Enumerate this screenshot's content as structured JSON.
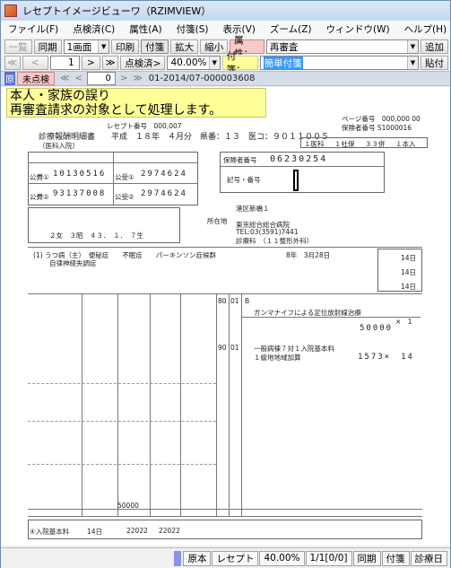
{
  "window": {
    "title": "レセプトイメージビューワ（RZIMVIEW）"
  },
  "menu": [
    "ファイル(F)",
    "点検済(C)",
    "属性(A)",
    "付箋(S)",
    "表示(V)",
    "ズーム(Z)",
    "ウィンドウ(W)",
    "ヘルプ(H)"
  ],
  "toolbar1": {
    "list": "一覧",
    "sync": "同期",
    "screen_select": "1画面",
    "print": "印刷",
    "sticky": "付箋",
    "zoom_in": "拡大",
    "zoom_out": "縮小",
    "attribute_label": "属性：",
    "attribute_value": "再審査",
    "add": "追加"
  },
  "toolbar2": {
    "first": "≪",
    "prev": "<",
    "page": "1",
    "next": ">",
    "last": "≫",
    "checked": "点検済>",
    "zoom": "40.00%",
    "sticky_label": "付箋：",
    "sticky_value": "簡単付箋",
    "paste": "貼付"
  },
  "nav": {
    "badge": "原",
    "tag": "未点検",
    "first": "≪",
    "prev": "<",
    "page": "0",
    "next": ">",
    "last": "≫",
    "doc_id": "01-2014/07-000003608"
  },
  "note": {
    "line1": "本人・家族の誤り",
    "line2": "再審査請求の対象として処理します。"
  },
  "receipt": {
    "receipt_no": "レセプト番号　000,007",
    "page_no": "ページ番号　000,000 00",
    "insurer_no": "保険者番号 S1000016",
    "head1": "診療報酬明細書　　平成　１８年　４月分　県番：１３　医コ：９０１１００５",
    "head2": "（医科入院）",
    "public1_label": "公費①",
    "public1_no": "10130516",
    "public2_label": "公費②",
    "public2_no": "93137008",
    "recipient1_label": "公受①",
    "recipient1_no": "2974624",
    "recipient2_label": "公受②",
    "recipient2_no": "2974624",
    "insurer_label": "保険者番号",
    "insurer_digits": "06230254",
    "symbol_label": "記号・番号",
    "kind1": "１医科",
    "kind2": "１社保",
    "kind3": "３３併",
    "kind4": "１本入",
    "name": "２女　３昭　４３．　１．　７生",
    "address_label": "所在地",
    "hospital_area": "港区新橋１",
    "hospital_name": "東京総合総合病院",
    "hospital_tel": "TEL:03(3591)7441",
    "hospital_dept": "診療科　（１１整形外科）",
    "disease": "(1) うつ病（主）　便秘症　　不眠症　　パーキンソン症候群",
    "disease2": "自律神経失調症",
    "start_date": "8年　3月28日",
    "day_a": "14日",
    "day_b": "14日",
    "day_c": "14日",
    "row_80": "80",
    "row_80b": "01",
    "row_90": "90",
    "row_90b": "01",
    "item_b": "B",
    "item_b_text": "ガンマナイフによる定位放射線治療",
    "item_b_qty": "×　1",
    "item_b_amount": "50000",
    "item_bed": "一般病棟７対１入院基本料",
    "item_bed2": "１級地地域加算",
    "item_bed_amount": "1573×　14",
    "sum_a": "50000",
    "total_label": "④入院基本料",
    "total_days": "14日",
    "total_pts": "22022",
    "total_pts2": "22022"
  },
  "status": {
    "original": "原本",
    "receipt": "レセプト",
    "zoom": "40.00%",
    "pages": "1/1[0/0]",
    "sync": "同期",
    "sticky": "付箋",
    "date": "診療日"
  }
}
